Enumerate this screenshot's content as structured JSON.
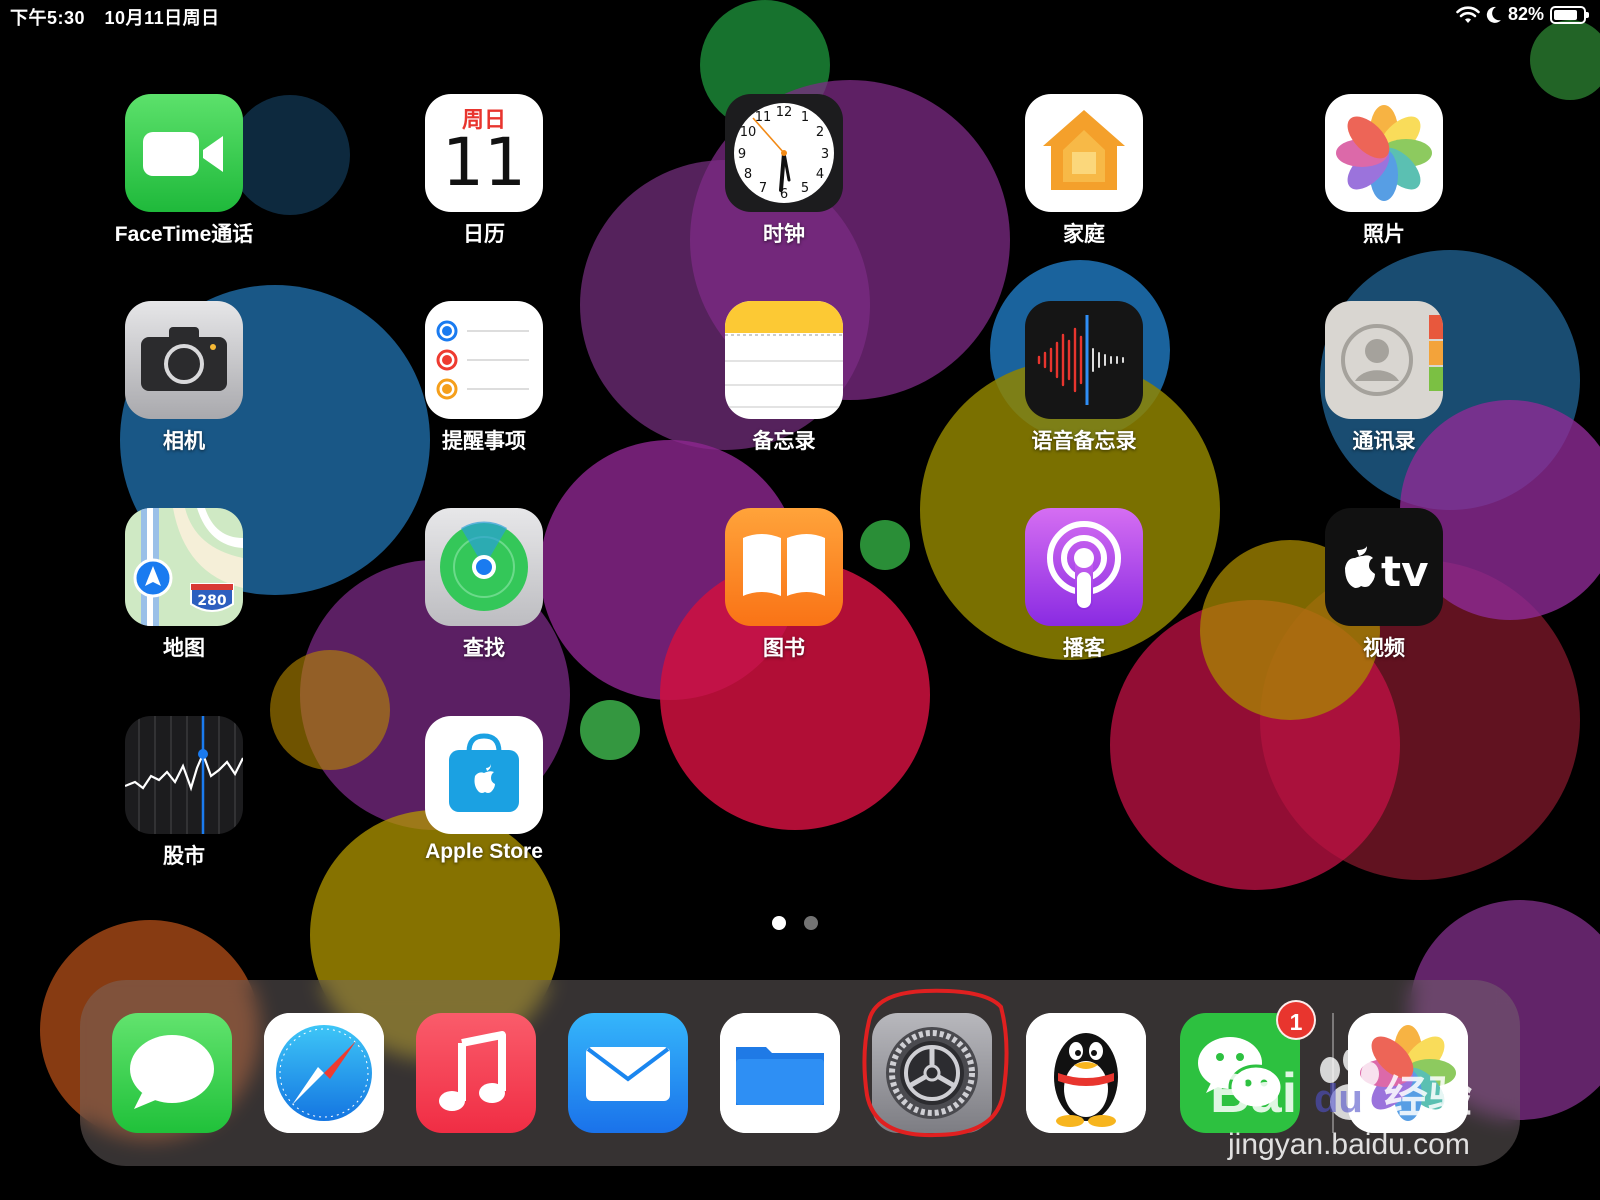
{
  "status_bar": {
    "time": "下午5:30",
    "date": "10月11日周日",
    "battery_text": "82%",
    "battery_level": 0.82,
    "icons": [
      "wifi-icon",
      "moon-icon",
      "battery-icon"
    ]
  },
  "apps": [
    {
      "name": "facetime",
      "label": "FaceTime通话"
    },
    {
      "name": "calendar",
      "label": "日历",
      "weekday": "周日",
      "day": "11"
    },
    {
      "name": "clock",
      "label": "时钟"
    },
    {
      "name": "home",
      "label": "家庭"
    },
    {
      "name": "photos",
      "label": "照片"
    },
    {
      "name": "camera",
      "label": "相机"
    },
    {
      "name": "reminders",
      "label": "提醒事项"
    },
    {
      "name": "notes",
      "label": "备忘录"
    },
    {
      "name": "voice-memos",
      "label": "语音备忘录"
    },
    {
      "name": "contacts",
      "label": "通讯录"
    },
    {
      "name": "maps",
      "label": "地图",
      "route_number": "280"
    },
    {
      "name": "find-my",
      "label": "查找"
    },
    {
      "name": "books",
      "label": "图书"
    },
    {
      "name": "podcasts",
      "label": "播客"
    },
    {
      "name": "tv",
      "label": "视频",
      "tv_text": "tv"
    },
    {
      "name": "stocks",
      "label": "股市"
    },
    {
      "name": "apple-store",
      "label": "Apple Store"
    }
  ],
  "page_indicator": {
    "pages": 2,
    "current": 1
  },
  "dock": {
    "apps": [
      "messages",
      "safari",
      "music",
      "mail",
      "files",
      "settings",
      "qq",
      "wechat",
      "photos-recent"
    ],
    "wechat_badge": "1",
    "highlighted": "settings"
  },
  "watermark": {
    "logo_text": "Bai du 经验",
    "url": "jingyan.baidu.com"
  },
  "colors": {
    "facetime": "#3ac74e",
    "reminders_blue": "#1a7bf0",
    "settings_gray": "#8e8e93",
    "badge": "#e8352e"
  }
}
